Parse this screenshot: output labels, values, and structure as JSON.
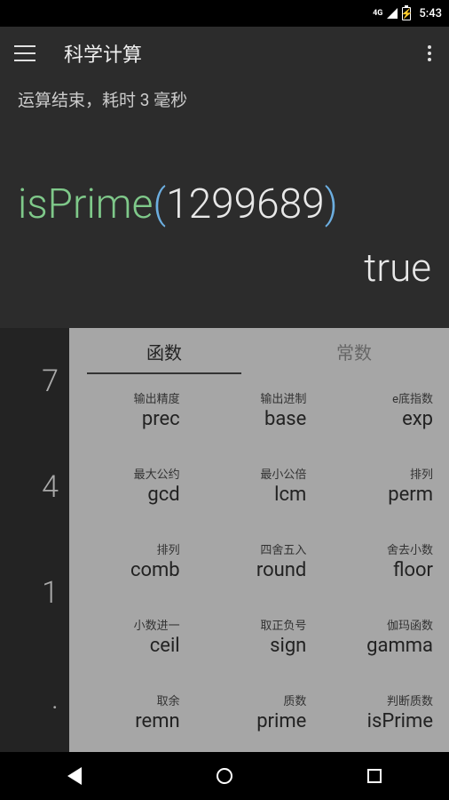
{
  "status": {
    "net": "4G",
    "time": "5:43"
  },
  "toolbar": {
    "title": "科学计算"
  },
  "statusLine": "运算结束，耗时 3 毫秒",
  "expr": {
    "fn": "isPrime",
    "lp": "(",
    "num": "1299689",
    "rp": ")"
  },
  "result": "true",
  "digits": [
    "7",
    "4",
    "1",
    "."
  ],
  "tabs": {
    "functions": "函数",
    "constants": "常数"
  },
  "fns": [
    {
      "sub": "输出精度",
      "main": "prec"
    },
    {
      "sub": "输出进制",
      "main": "base"
    },
    {
      "sub": "e底指数",
      "main": "exp"
    },
    {
      "sub": "最大公约",
      "main": "gcd"
    },
    {
      "sub": "最小公倍",
      "main": "lcm"
    },
    {
      "sub": "排列",
      "main": "perm"
    },
    {
      "sub": "排列",
      "main": "comb"
    },
    {
      "sub": "四舍五入",
      "main": "round"
    },
    {
      "sub": "舍去小数",
      "main": "floor"
    },
    {
      "sub": "小数进一",
      "main": "ceil"
    },
    {
      "sub": "取正负号",
      "main": "sign"
    },
    {
      "sub": "伽玛函数",
      "main": "gamma"
    },
    {
      "sub": "取余",
      "main": "remn"
    },
    {
      "sub": "质数",
      "main": "prime"
    },
    {
      "sub": "判断质数",
      "main": "isPrime"
    }
  ]
}
